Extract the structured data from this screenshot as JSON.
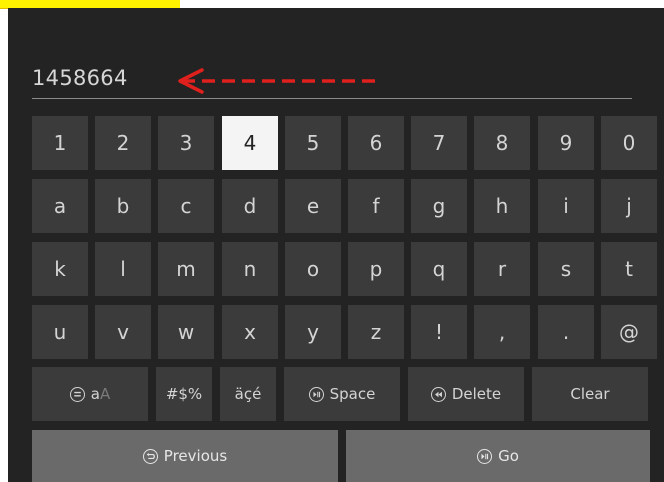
{
  "input": {
    "value": "1458664"
  },
  "keyboard": {
    "rows": [
      [
        "1",
        "2",
        "3",
        "4",
        "5",
        "6",
        "7",
        "8",
        "9",
        "0"
      ],
      [
        "a",
        "b",
        "c",
        "d",
        "e",
        "f",
        "g",
        "h",
        "i",
        "j"
      ],
      [
        "k",
        "l",
        "m",
        "n",
        "o",
        "p",
        "q",
        "r",
        "s",
        "t"
      ],
      [
        "u",
        "v",
        "w",
        "x",
        "y",
        "z",
        "!",
        ",",
        ".",
        "@"
      ]
    ],
    "selected_key": "4",
    "func": {
      "case_a": "a",
      "case_A": "A",
      "symbols": "#$%",
      "accents": "äçé",
      "space": "Space",
      "delete": "Delete",
      "clear": "Clear"
    }
  },
  "nav": {
    "previous": "Previous",
    "go": "Go"
  },
  "annotation": {
    "arrow_color": "#e0201c"
  },
  "icons": {
    "case": "menu-icon",
    "space": "play-pause-icon",
    "delete": "rewind-icon",
    "previous": "back-icon",
    "go": "play-pause-icon"
  }
}
